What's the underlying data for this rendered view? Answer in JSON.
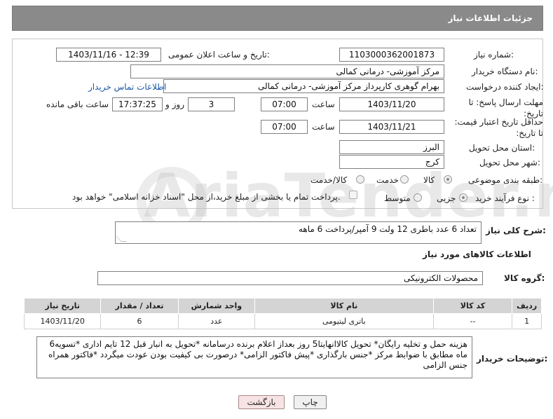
{
  "header": {
    "title": "جزئیات اطلاعات نیاز"
  },
  "form": {
    "need_number_label": "شماره نیاز:",
    "need_number": "1103000362001873",
    "announce_label": "تاریخ و ساعت اعلان عمومی:",
    "announce_value": "1403/11/16 - 12:39",
    "buyer_label": "نام دستگاه خریدار:",
    "buyer_value": "مرکز آموزشی- درمانی کمالی",
    "creator_label": "ایجاد کننده درخواست:",
    "creator_value": "بهرام گوهری کارپرداز مرکز آموزشی- درمانی کمالی",
    "contact_link": "اطلاعات تماس خریدار",
    "deadline_label": "مهلت ارسال پاسخ: تا تاریخ:",
    "deadline_date": "1403/11/20",
    "time_label": "ساعت",
    "deadline_time": "07:00",
    "days_value": "3",
    "days_label": "روز و",
    "remaining_time": "17:37:25",
    "remaining_label": "ساعت باقی مانده",
    "validity_label": "حداقل تاریخ اعتبار قیمت: تا تاریخ:",
    "validity_date": "1403/11/21",
    "validity_time_label": "ساعت",
    "validity_time": "07:00",
    "province_label": "استان محل تحویل:",
    "province_value": "البرز",
    "city_label": "شهر محل تحویل:",
    "city_value": "کرج",
    "category_label": "طبقه بندی موضوعی:",
    "category_options": [
      "کالا",
      "خدمت",
      "کالا/خدمت"
    ],
    "process_label": "نوع فرآیند خرید :",
    "process_options": [
      "جزیی",
      "متوسط"
    ],
    "payment_note": "پرداخت تمام یا بخشی از مبلغ خرید،از محل \"اسناد خزانه اسلامی\" خواهد بود."
  },
  "description": {
    "label": "شرح کلی نیاز:",
    "value": "تعداد 6 عدد باطری 12 ولت 9 آمپر/پرداخت 6 ماهه"
  },
  "goods": {
    "section_title": "اطلاعات کالاهای مورد نیاز",
    "group_label": "گروه کالا:",
    "group_value": "محصولات الکترونیکی",
    "columns": [
      "ردیف",
      "کد کالا",
      "نام کالا",
      "واحد شمارش",
      "تعداد / مقدار",
      "تاریخ نیاز"
    ],
    "rows": [
      [
        "1",
        "--",
        "باتری لیتیومی",
        "عدد",
        "6",
        "1403/11/20"
      ]
    ]
  },
  "buyer_notes": {
    "label": "توضیحات خریدار:",
    "value": "هزینه حمل و تخلیه رایگان* تحویل کالاانهایتا5 روز بعداز اعلام برنده درسامانه *تحویل به انبار قبل 12 تایم اداری *تسویه6 ماه مطابق با ضوابط مرکز *جنس بارگذاری *پیش فاکتور الزامی* درصورت بی کیفیت بودن عودت میگردد *فاکتور همراه جنس الزامی"
  },
  "buttons": {
    "print": "چاپ",
    "back": "بازگشت"
  },
  "watermark": {
    "text": "AriaTender.neT"
  }
}
